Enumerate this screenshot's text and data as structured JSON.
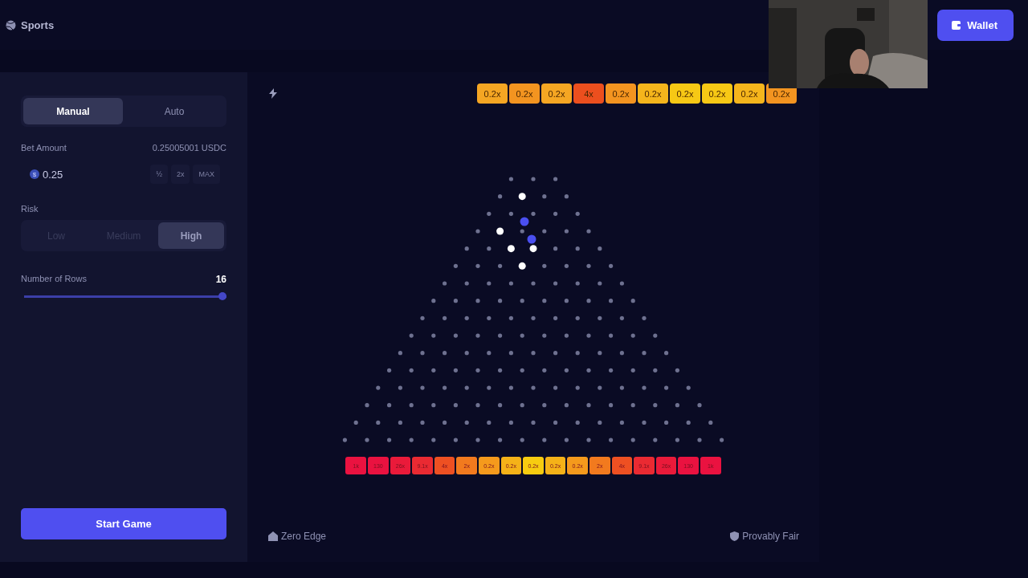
{
  "header": {
    "nav_label": "Sports",
    "wallet_button": "Wallet"
  },
  "controls": {
    "modes": [
      {
        "label": "Manual",
        "selected": true
      },
      {
        "label": "Auto",
        "selected": false
      }
    ],
    "bet_label": "Bet Amount",
    "balance": "0.25005001 USDC",
    "currency_symbol": "$",
    "bet_value": "0.25",
    "bet_buttons": [
      "½",
      "2x",
      "MAX"
    ],
    "risk_label": "Risk",
    "risks": [
      {
        "label": "Low",
        "selected": false
      },
      {
        "label": "Medium",
        "selected": false
      },
      {
        "label": "High",
        "selected": true
      }
    ],
    "rows_label": "Number of Rows",
    "rows_value": "16",
    "rows_slider": {
      "level": 1
    },
    "start_button": "Start Game"
  },
  "history": [
    {
      "label": "0.2x",
      "color": "#f5a623"
    },
    {
      "label": "0.2x",
      "color": "#f39420"
    },
    {
      "label": "0.2x",
      "color": "#f5a623"
    },
    {
      "label": "4x",
      "color": "#ec4f1e"
    },
    {
      "label": "0.2x",
      "color": "#f39420"
    },
    {
      "label": "0.2x",
      "color": "#f5b51c"
    },
    {
      "label": "0.2x",
      "color": "#f7c815"
    },
    {
      "label": "0.2x",
      "color": "#f7c815"
    },
    {
      "label": "0.2x",
      "color": "#f5b51c"
    },
    {
      "label": "0.2x",
      "color": "#f39420"
    }
  ],
  "bins": [
    {
      "label": "1k",
      "color": "#ea1240"
    },
    {
      "label": "130",
      "color": "#ea1240"
    },
    {
      "label": "26x",
      "color": "#ea1a3a"
    },
    {
      "label": "9.1x",
      "color": "#ea2a32"
    },
    {
      "label": "4x",
      "color": "#ee5022"
    },
    {
      "label": "2x",
      "color": "#f27a1e"
    },
    {
      "label": "0.2x",
      "color": "#f59a1c"
    },
    {
      "label": "0.2x",
      "color": "#f5b218"
    },
    {
      "label": "0.2x",
      "color": "#f7cc10"
    },
    {
      "label": "0.2x",
      "color": "#f5b218"
    },
    {
      "label": "0.2x",
      "color": "#f59a1c"
    },
    {
      "label": "2x",
      "color": "#f27a1e"
    },
    {
      "label": "4x",
      "color": "#ee5022"
    },
    {
      "label": "9.1x",
      "color": "#ea2a32"
    },
    {
      "label": "26x",
      "color": "#ea1a3a"
    },
    {
      "label": "130",
      "color": "#ea1240"
    },
    {
      "label": "1k",
      "color": "#ea1240"
    }
  ],
  "footer": {
    "left": "Zero Edge",
    "right": "Provably Fair"
  }
}
